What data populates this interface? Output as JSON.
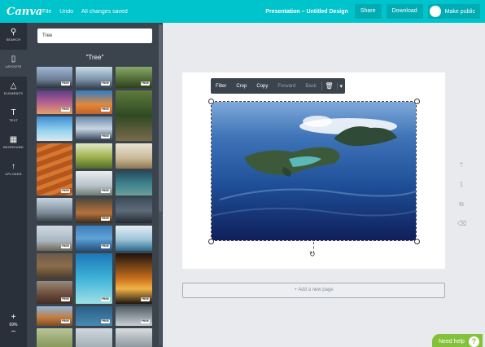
{
  "topbar": {
    "logo": "Canva",
    "menu": [
      "File",
      "Undo",
      "All changes saved"
    ],
    "doc_title": "Presentation – Untitled Design",
    "share_label": "Share",
    "download_label": "Download",
    "make_public_label": "Make public",
    "color": "#00c4cc"
  },
  "rail": {
    "items": [
      {
        "label": "SEARCH",
        "icon": "search-icon",
        "glyph": "⚲"
      },
      {
        "label": "LAYOUTS",
        "icon": "layouts-icon",
        "glyph": "▯"
      },
      {
        "label": "ELEMENTS",
        "icon": "elements-icon",
        "glyph": "△"
      },
      {
        "label": "TEXT",
        "icon": "text-icon",
        "glyph": "T"
      },
      {
        "label": "BKGROUND",
        "icon": "background-icon",
        "glyph": "▦"
      },
      {
        "label": "UPLOADS",
        "icon": "upload-icon",
        "glyph": "↑"
      }
    ],
    "zoom_in": "+",
    "zoom_value": "69%",
    "zoom_out": "−"
  },
  "panel": {
    "search_value": "Tree",
    "results_title": "\"Tree\"",
    "badges": [
      "FREE",
      "FREE",
      "FREE",
      "FREE",
      "FREE",
      "FREE",
      "FREE",
      "FREE",
      "FREE",
      "FREE",
      "FREE",
      "FREE",
      "FREE",
      "FREE",
      "FREE",
      "FREE",
      "FREE"
    ]
  },
  "toolbar": {
    "filter": "Filter",
    "crop": "Crop",
    "copy": "Copy",
    "forward": "Forward",
    "back": "Back"
  },
  "side_tools": [
    "⇡",
    "1",
    "⧉",
    "⌫"
  ],
  "add_page_label": "+ Add a new page",
  "help_label": "Need help",
  "help_glyph": "?",
  "colors": {
    "rail_bg": "#293039",
    "panel_bg": "#3b434d",
    "help_green": "#84c13b"
  }
}
